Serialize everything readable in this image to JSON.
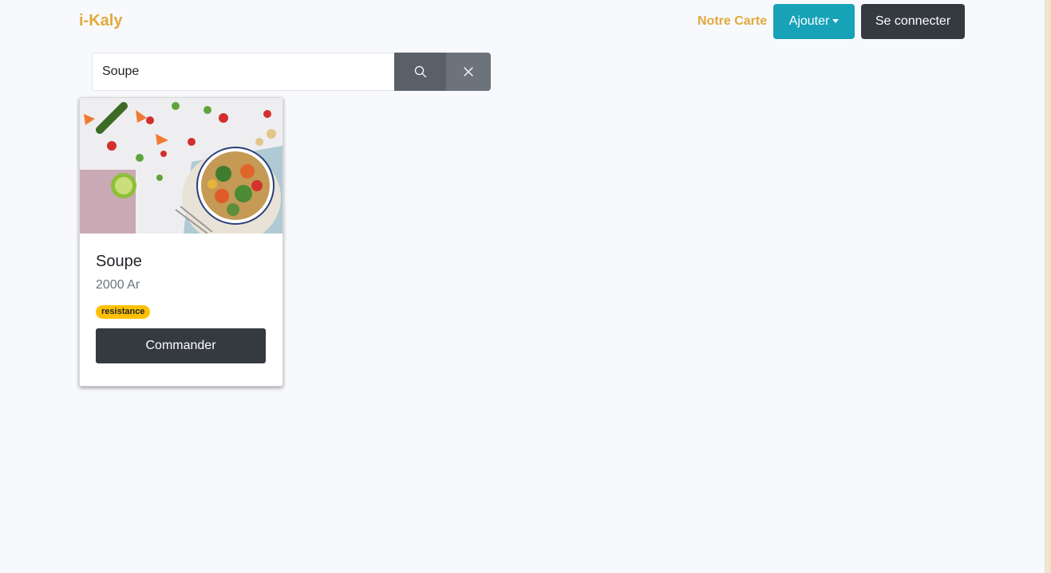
{
  "navbar": {
    "brand": "i-Kaly",
    "nav_link": "Notre Carte",
    "add_button": "Ajouter",
    "login_button": "Se connecter"
  },
  "search": {
    "value": "Soupe",
    "search_icon": "search-icon",
    "clear_icon": "close-icon"
  },
  "results": [
    {
      "title": "Soupe",
      "price": "2000 Ar",
      "badge": "resistance",
      "order_button": "Commander"
    }
  ],
  "colors": {
    "brand": "#e0a93c",
    "info": "#17a2b8",
    "dark": "#343a40",
    "badge": "#ffc107"
  }
}
